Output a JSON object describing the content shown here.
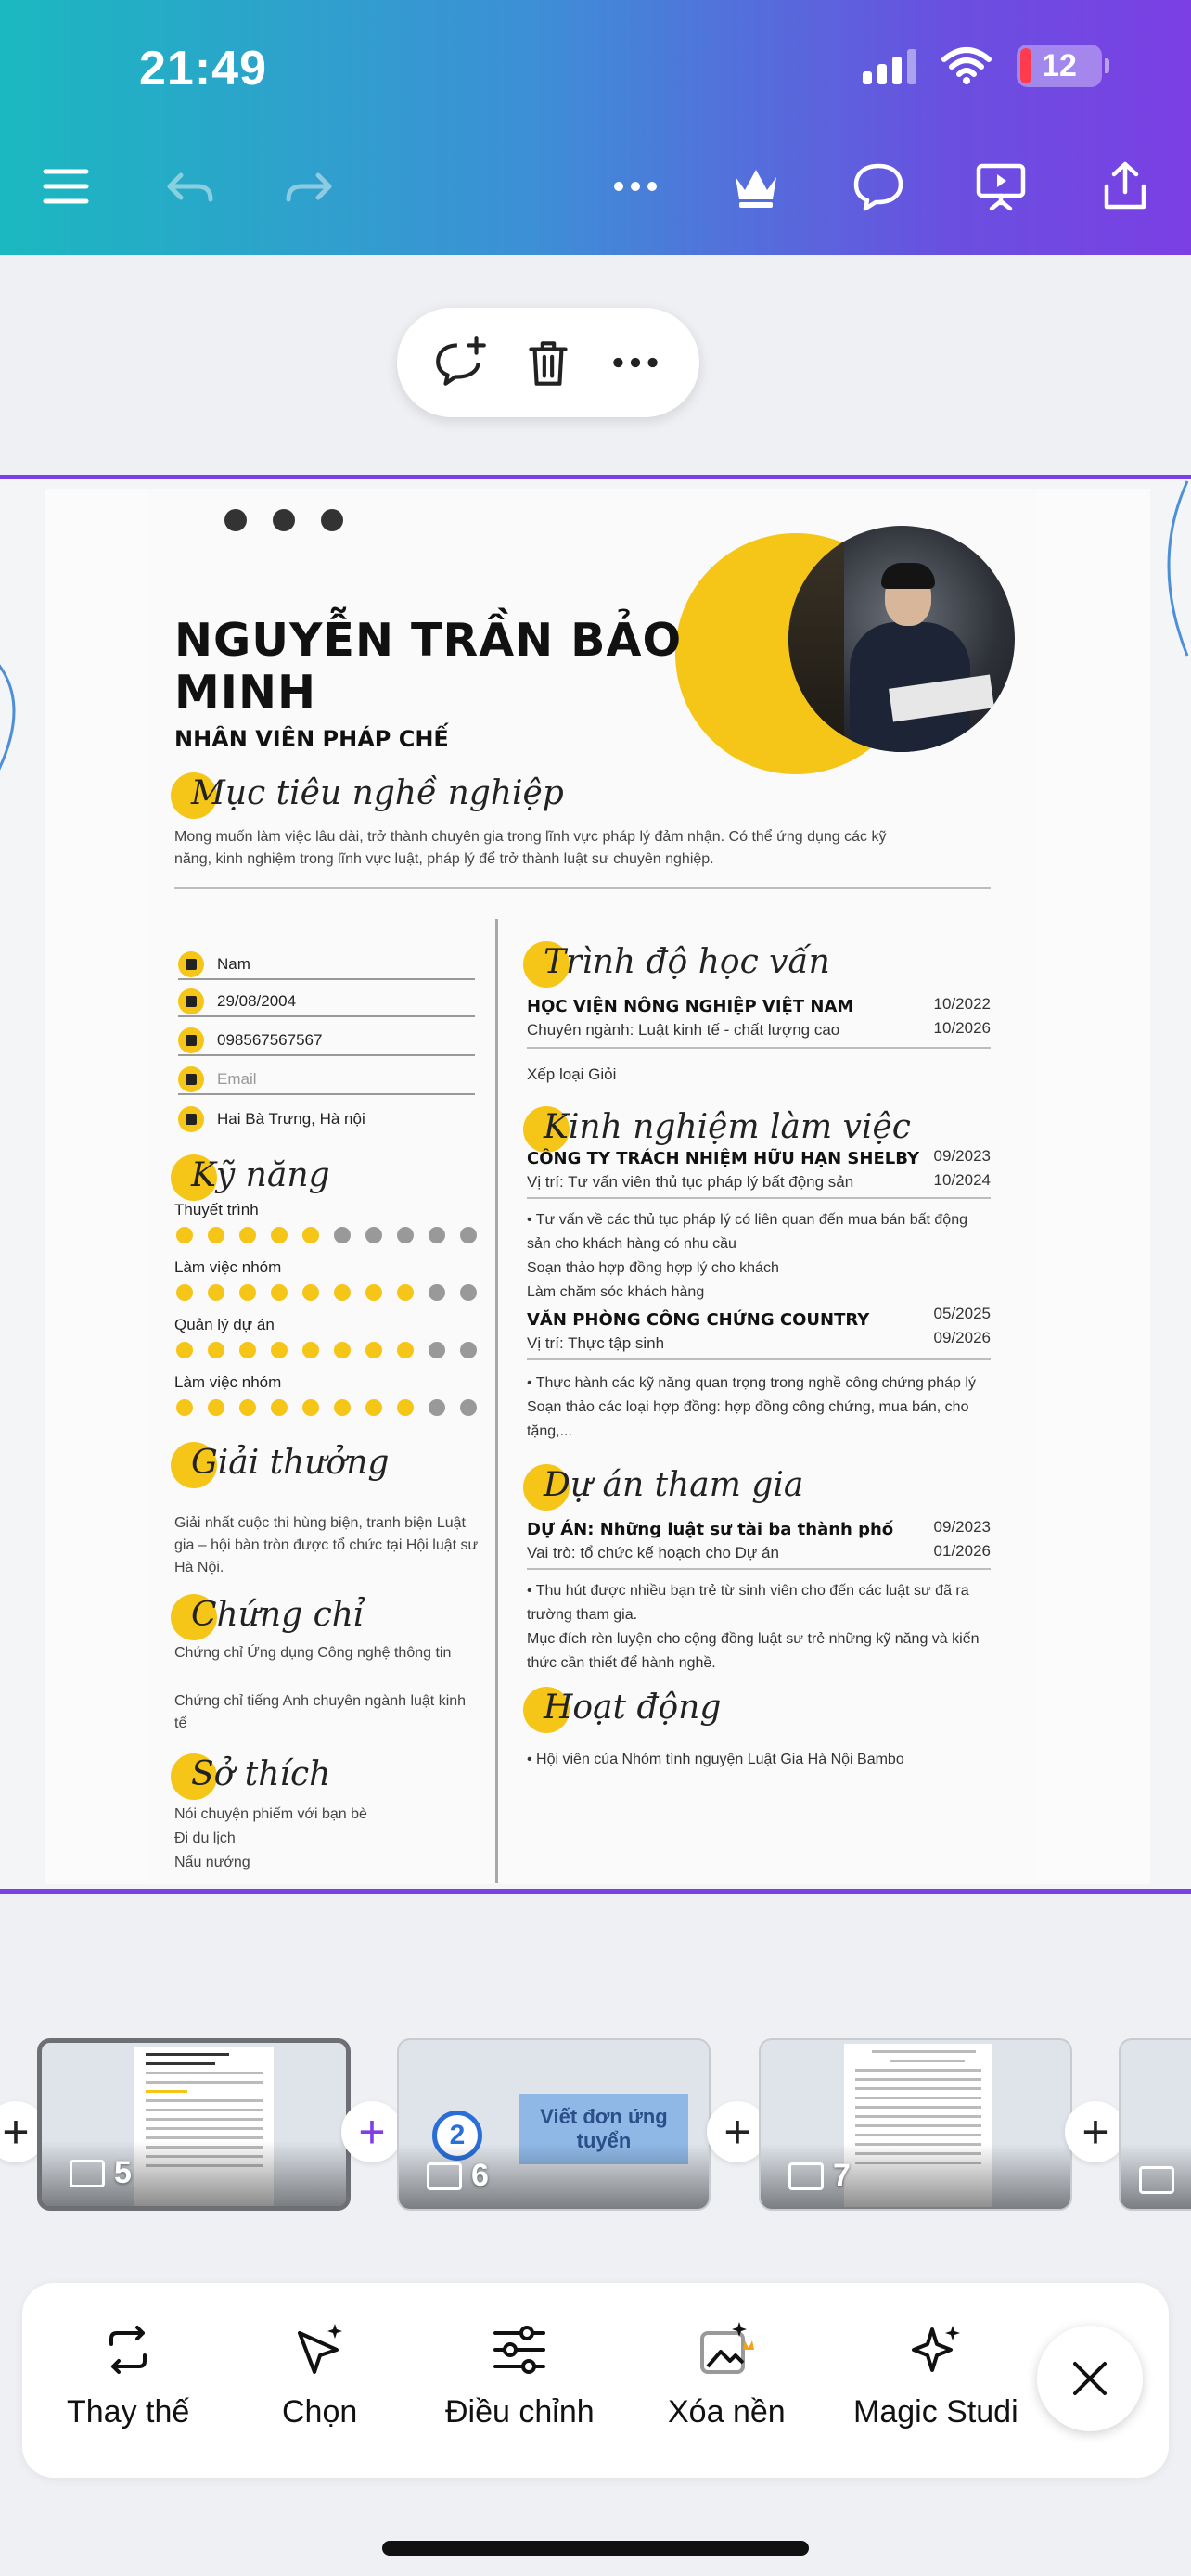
{
  "status_bar": {
    "time": "21:49",
    "battery": "12"
  },
  "cv": {
    "name": "NGUYỄN TRẦN BẢO MINH",
    "role": "NHÂN VIÊN PHÁP CHẾ",
    "objective_title": "Mục tiêu nghề nghiệp",
    "objective_text": "Mong muốn làm việc lâu dài, trở thành chuyên gia trong lĩnh vực pháp lý đảm nhận. Có thể ứng dụng các kỹ năng, kinh nghiệm trong lĩnh vực luật, pháp lý để trở thành luật sư chuyên nghiệp.",
    "info": {
      "gender": "Nam",
      "dob": "29/08/2004",
      "phone": "098567567567",
      "email_placeholder": "Email",
      "address": "Hai Bà Trưng, Hà nội"
    },
    "skills_title": "Kỹ năng",
    "skills": [
      {
        "name": "Thuyết trình",
        "level": 5
      },
      {
        "name": "Làm việc nhóm",
        "level": 8
      },
      {
        "name": "Quản lý dự án",
        "level": 8
      },
      {
        "name": "Làm việc nhóm",
        "level": 8
      }
    ],
    "awards_title": "Giải thưởng",
    "awards_text": "Giải nhất cuộc thi hùng biện, tranh biện Luật gia – hội bàn tròn được tổ chức tại Hội luật sư Hà Nội.",
    "certs_title": "Chứng chỉ",
    "certs": [
      "Chứng chỉ Ứng dụng Công nghệ thông tin",
      "Chứng chỉ tiếng Anh chuyên ngành luật kinh tế"
    ],
    "hobbies_title": "Sở thích",
    "hobbies": [
      "Nói chuyện phiếm với bạn bè",
      "Đi du lịch",
      "Nấu nướng"
    ],
    "education_title": "Trình độ học vấn",
    "education": {
      "school": "HỌC VIỆN NÔNG NGHIỆP VIỆT NAM",
      "major": "Chuyên ngành: Luật kinh tế - chất lượng cao",
      "from": "10/2022",
      "to": "10/2026",
      "grade": "Xếp loại Giỏi"
    },
    "experience_title": "Kinh nghiệm làm việc",
    "experience": [
      {
        "company": "CÔNG TY TRÁCH NHIỆM HỮU HẠN SHELBY",
        "position": "Vị trí: Tư vấn viên thủ tục pháp lý bất động sản",
        "from": "09/2023",
        "to": "10/2024",
        "details": "• Tư vấn về các thủ tục pháp lý có liên quan đến mua bán bất động sản cho khách hàng có nhu cầu\nSoạn thảo hợp đồng hợp lý cho khách\nLàm chăm sóc khách hàng"
      },
      {
        "company": "VĂN PHÒNG CÔNG CHỨNG COUNTRY",
        "position": "Vị trí: Thực tập sinh",
        "from": "05/2025",
        "to": "09/2026",
        "details": "• Thực hành các kỹ năng quan trọng trong nghề công chứng pháp lý\nSoạn thảo các loại hợp đồng: hợp đồng công chứng, mua bán, cho tặng,..."
      }
    ],
    "projects_title": "Dự án tham gia",
    "project": {
      "name": "DỰ ÁN: Những luật sư tài ba thành phố",
      "role": "Vai trò: tổ chức kế hoạch cho Dự án",
      "from": "09/2023",
      "to": "01/2026",
      "details": "• Thu hút được nhiều bạn trẻ từ sinh viên cho đến các luật sư đã ra trường tham gia.\nMục đích rèn luyện cho cộng đồng luật sư trẻ những kỹ năng và kiến thức cần thiết để hành nghề."
    },
    "activities_title": "Hoạt động",
    "activities": "• Hội viên của Nhóm tình nguyện Luật Gia Hà Nội Bambo"
  },
  "thumbnails": [
    {
      "page": "5",
      "selected": true
    },
    {
      "page": "6",
      "card_text": "Viết đơn ứng tuyển",
      "badge": "2"
    },
    {
      "page": "7"
    }
  ],
  "tools": {
    "replace": "Thay thế",
    "select": "Chọn",
    "adjust": "Điều chỉnh",
    "remove_bg": "Xóa nền",
    "magic": "Magic Studi"
  },
  "colors": {
    "accent_purple": "#7d3fe6",
    "cv_yellow": "#f5c518"
  }
}
